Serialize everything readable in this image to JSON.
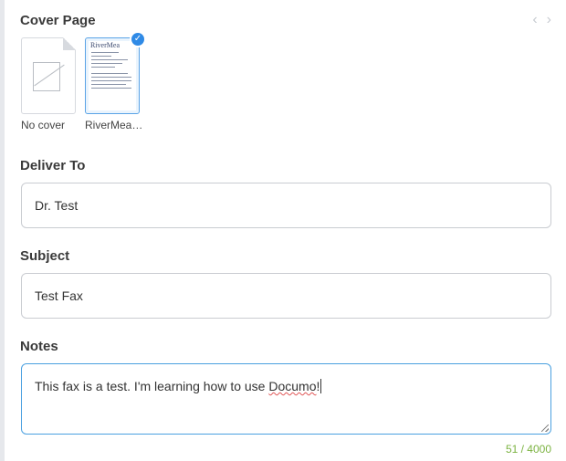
{
  "cover_page": {
    "label": "Cover Page",
    "prev_icon": "chevron-left-icon",
    "next_icon": "chevron-right-icon",
    "options": [
      {
        "label": "No cover",
        "selected": false
      },
      {
        "label": "RiverMea…",
        "selected": true,
        "preview_title": "RiverMea"
      }
    ]
  },
  "deliver_to": {
    "label": "Deliver To",
    "value": "Dr. Test"
  },
  "subject": {
    "label": "Subject",
    "value": "Test Fax"
  },
  "notes": {
    "label": "Notes",
    "value_prefix": "This fax is a test. I'm learning how to use ",
    "value_misspelled": "Documo",
    "value_suffix": "!",
    "counter": "51 / 4000"
  },
  "colors": {
    "accent": "#2f8ae6",
    "focus_border": "#4aa0e0",
    "counter": "#7cb342"
  }
}
